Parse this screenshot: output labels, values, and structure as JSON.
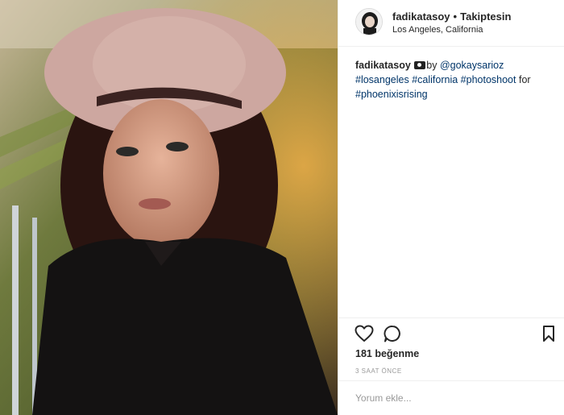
{
  "post": {
    "username": "fadikatasoy",
    "separator": "•",
    "follow_status": "Takiptesin",
    "location": "Los Angeles, California"
  },
  "caption": {
    "username": "fadikatasoy",
    "camera_icon": "camera-emoji-icon",
    "by": "by",
    "mention": "@gokaysarioz",
    "tag1": "#losangeles",
    "tag2": "#california",
    "tag3": "#photoshoot",
    "for": "for",
    "tag4": "#phoenixisrising"
  },
  "actions": {
    "like_icon": "heart-icon",
    "comment_icon": "comment-bubble-icon",
    "save_icon": "bookmark-icon"
  },
  "likes": "181 beğenme",
  "timestamp": "3 SAAT ÖNCE",
  "comment_box": {
    "placeholder": "Yorum ekle..."
  },
  "colors": {
    "link": "#003569",
    "border": "#efefef",
    "muted": "#999999"
  }
}
